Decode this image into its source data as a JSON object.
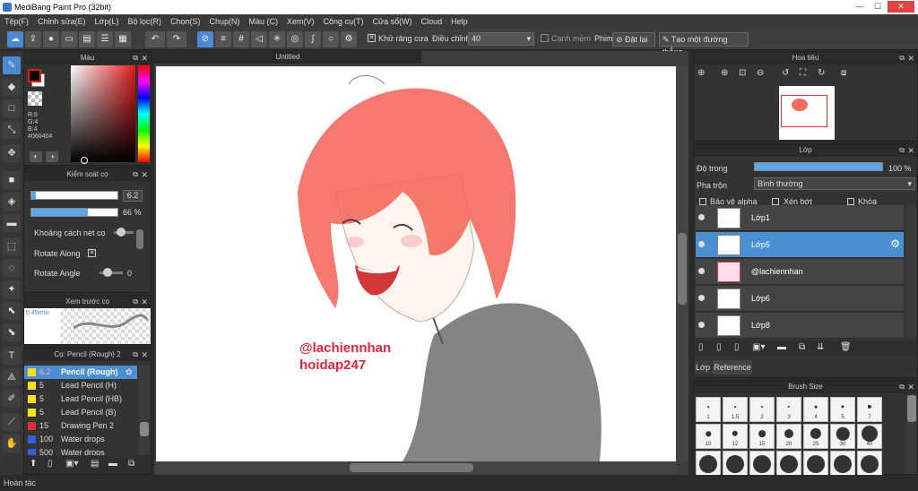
{
  "window": {
    "title": "MediBang Paint Pro (32bit)",
    "min": "—",
    "max": "☐",
    "close": "✕"
  },
  "menu": [
    "Tệp(F)",
    "Chỉnh sửa(E)",
    "Lớp(L)",
    "Bộ lọc(R)",
    "Chọn(S)",
    "Chụp(N)",
    "Màu (C)",
    "Xem(V)",
    "Công cụ(T)",
    "Cửa sổ(W)",
    "Cloud",
    "Help"
  ],
  "toolbar": {
    "antialias_label": "Khử răng cưa",
    "adjust_label": "Điều chỉnh",
    "adjust_value": "40",
    "edge_label": "Cạnh mềm",
    "pen_label": "Phim",
    "reset_label": "Đặt lại",
    "line_label": "Tạo một đường thẳng"
  },
  "color_panel": {
    "title": "Màu",
    "r": "R:6",
    "g": "G:4",
    "b": "B:4",
    "hex": "#060404",
    "fg": "#060404",
    "bg": "#ffffff",
    "accent": "#e21b1b"
  },
  "brush_control": {
    "title": "Kiểm soát cọ",
    "size_value": "6.2",
    "opacity_value": "66 %",
    "opacity_fraction": 0.66,
    "size_fraction": 0.05,
    "spacing_label": "Khoảng cách nét cọ",
    "rotate_along": "Rotate Along",
    "rotate_angle": "Rotate Angle",
    "rotate_angle_value": "0"
  },
  "preview": {
    "title": "Xem trước cọ",
    "size": "0.45mm"
  },
  "brush_list": {
    "title": "Cọ: Pencil (Rough) 2",
    "items": [
      {
        "size": "6.2",
        "name": "Pencil (Rough)",
        "color": "#f5e21b",
        "selected": true
      },
      {
        "size": "5",
        "name": "Lead Pencil (H)",
        "color": "#f5e21b"
      },
      {
        "size": "5",
        "name": "Lead Pencil (HB)",
        "color": "#f5e21b"
      },
      {
        "size": "5",
        "name": "Lead Pencil (B)",
        "color": "#f5e21b"
      },
      {
        "size": "15",
        "name": "Drawing Pen 2",
        "color": "#e23030"
      },
      {
        "size": "100",
        "name": "Water drops",
        "color": "#3a5bd8"
      },
      {
        "size": "500",
        "name": "Water drops",
        "color": "#3a5bd8"
      }
    ]
  },
  "canvas": {
    "tab": "Untitled",
    "watermark1": "@lachiennhan",
    "watermark2": "hoidap247",
    "hair": "#f46a5e",
    "shirt": "#6e6e6e"
  },
  "navigator": {
    "title": "Hoa tiêu"
  },
  "layers": {
    "title": "Lớp",
    "opacity_label": "Độ trong",
    "opacity_value": "100 %",
    "opacity_fraction": 1,
    "blend_label": "Pha trộn",
    "blend_value": "Bình thường",
    "protect_alpha": "Bảo vệ alpha",
    "clip": "Xén bớt",
    "lock": "Khóa",
    "items": [
      {
        "name": "Lớp1"
      },
      {
        "name": "Lớp5",
        "selected": true
      },
      {
        "name": "@lachiennhan"
      },
      {
        "name": "Lớp6"
      },
      {
        "name": "Lớp8"
      }
    ],
    "tab_layer": "Lớp",
    "tab_reference": "Reference"
  },
  "brush_size": {
    "title": "Brush Size",
    "sizes": [
      "1",
      "1.5",
      "2",
      "3",
      "4",
      "5",
      "7",
      "10",
      "12",
      "15",
      "20",
      "25",
      "30",
      "40"
    ]
  },
  "status": "Hoàn tác"
}
